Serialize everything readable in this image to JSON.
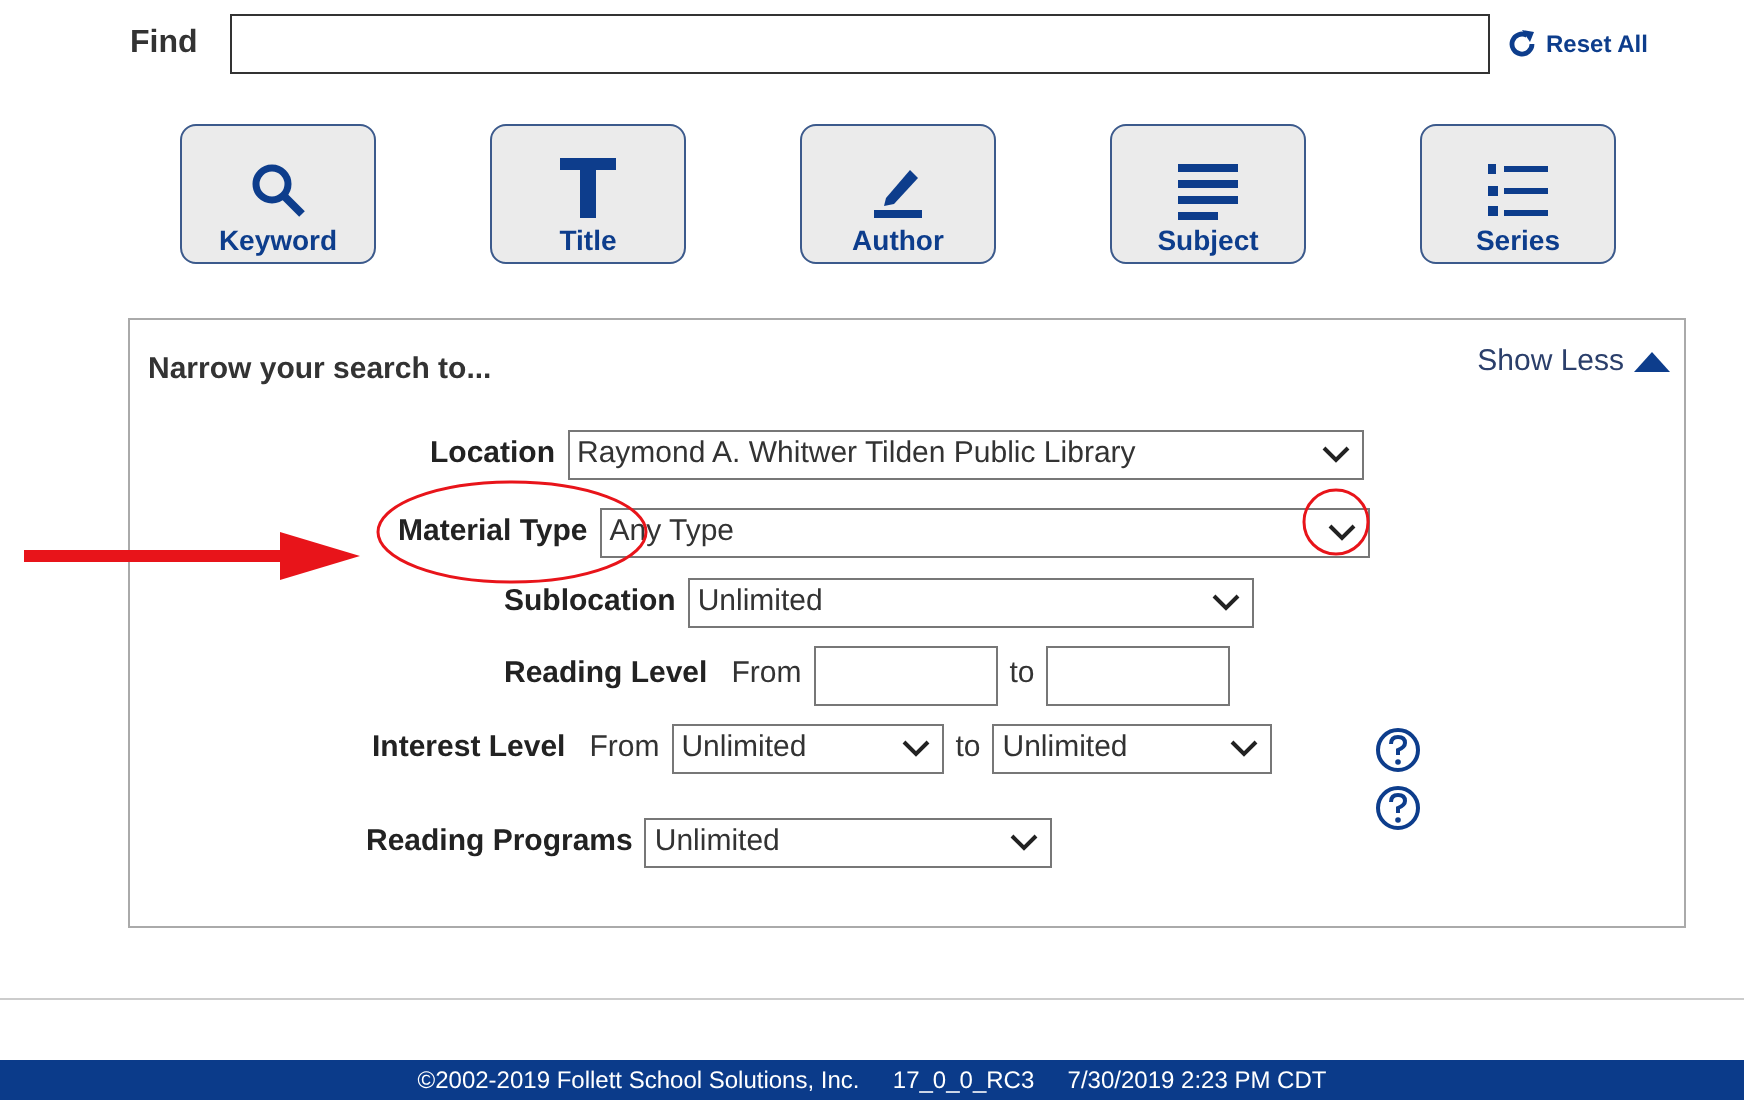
{
  "find": {
    "label": "Find",
    "reset": "Reset All"
  },
  "search_types": [
    {
      "kind": "keyword",
      "label": "Keyword"
    },
    {
      "kind": "title",
      "label": "Title"
    },
    {
      "kind": "author",
      "label": "Author"
    },
    {
      "kind": "subject",
      "label": "Subject"
    },
    {
      "kind": "series",
      "label": "Series"
    }
  ],
  "narrow": {
    "title": "Narrow your search to...",
    "toggle": "Show Less",
    "expanded": true,
    "rows": [
      {
        "kind": "select",
        "label": "Location",
        "value": "Raymond A. Whitwer Tilden Public Library",
        "help": false
      },
      {
        "kind": "select",
        "label": "Material Type",
        "value": "Any Type",
        "help": false
      },
      {
        "kind": "select",
        "label": "Sublocation",
        "value": "Unlimited",
        "help": false
      },
      {
        "kind": "range_input",
        "label": "Reading Level",
        "from": "From",
        "to": "to",
        "help": false
      },
      {
        "kind": "range_select",
        "label": "Interest Level",
        "from": "From",
        "from_value": "Unlimited",
        "to": "to",
        "to_value": "Unlimited",
        "help": true
      },
      {
        "kind": "select",
        "label": "Reading Programs",
        "value": "Unlimited",
        "help": true
      }
    ]
  },
  "footer": "©2002-2019 Follett School Solutions, Inc.     17_0_0_RC3     7/30/2019 2:23 PM CDT"
}
